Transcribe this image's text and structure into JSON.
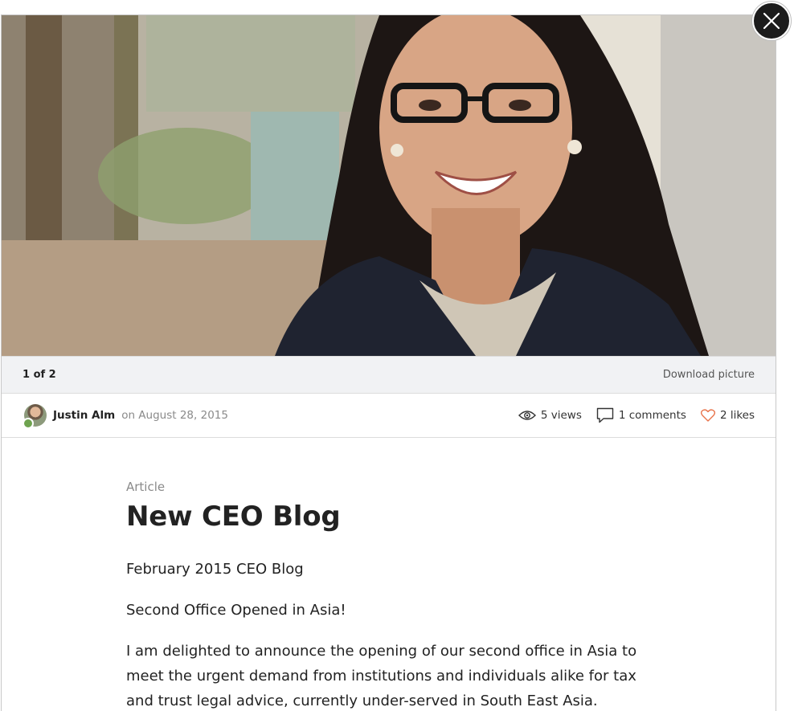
{
  "lightbox": {
    "counter": "1 of 2",
    "download_label": "Download picture"
  },
  "author": {
    "name": "Justin Alm",
    "date_text": "on August 28, 2015"
  },
  "stats": {
    "views": "5 views",
    "comments": "1 comments",
    "likes": "2 likes"
  },
  "article": {
    "type": "Article",
    "title": "New CEO Blog",
    "paragraphs": [
      "February 2015 CEO Blog",
      "Second Office Opened in Asia!",
      "I am delighted to announce the opening of our second office in Asia to meet the urgent demand from institutions and individuals alike for tax and trust legal advice, currently under-served in South East Asia."
    ]
  },
  "colors": {
    "online": "#6ea34f",
    "like_heart": "#e8734a",
    "close_bg": "#1c1c1c"
  },
  "icons": [
    "close-icon",
    "eye-icon",
    "comment-icon",
    "heart-icon"
  ]
}
